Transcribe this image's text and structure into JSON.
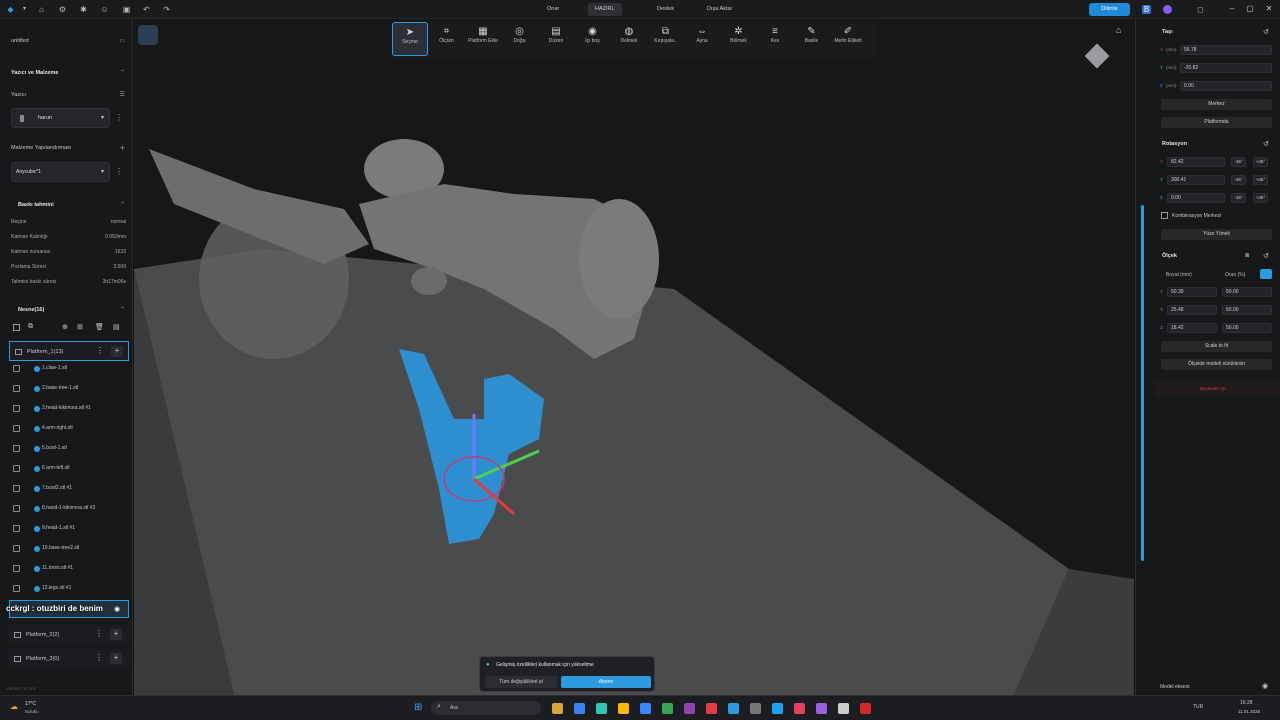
{
  "topbar": {
    "tabs": [
      {
        "label": "Onar"
      },
      {
        "label": "HAZIRL"
      },
      {
        "label": "Destek"
      },
      {
        "label": "Dışa Aktar"
      }
    ],
    "slice_label": "Dilimle"
  },
  "left": {
    "project_name": "untitled",
    "printer_section": "Yazıcı ve Malzeme",
    "printer_label": "Yazıcı",
    "printer_value": "harun",
    "material_label": "Malzeme Yapılandırması",
    "material_value": "Anycubic*1",
    "estimate_title": "Baskı tahmini",
    "estimates": [
      {
        "k": "Reçine",
        "v": "normal"
      },
      {
        "k": "Katman Kalınlığı",
        "v": "0.050mm"
      },
      {
        "k": "Katman numarası",
        "v": "1633"
      },
      {
        "k": "Pozlama Süresi",
        "v": "3.500"
      },
      {
        "k": "Tahmini baskı süresi",
        "v": "3h17m06s"
      }
    ],
    "objects_title": "Nesne(16)",
    "platform1": "Platform_1(13)",
    "objects": [
      "1.claw-1.stl",
      "2.base-tree-1.stl",
      "3.head-kikimora.stl #1",
      "4.arm-right.stl",
      "5.boot-1.stl",
      "6.arm-left.stl",
      "7.boot2.stl #1",
      "8.hand-1-kikimora.stl #2",
      "9.head-1.stl #1",
      "10.base-tree2.stl",
      "11.torso.stl #1",
      "12.legs.stl #1"
    ],
    "chat_overlay": "cckrgl : otuzbiri de benim",
    "platform2": "Platform_2(2)",
    "platform3": "Platform_3(0)",
    "version": "Version: v1.8.8"
  },
  "toolbar": [
    "Seçme",
    "Ölçüm",
    "Platform Ekle",
    "Doğu",
    "Düzen",
    "İçi boş",
    "Delmek",
    "Kırpıyala..",
    "Ayna",
    "Bölmek",
    "Kes",
    "Basile",
    "Metin Etiketi"
  ],
  "right": {
    "move_title": "Taşı",
    "move": [
      {
        "axis": "X",
        "unit": "(mm)",
        "v": "56.78"
      },
      {
        "axis": "Y",
        "unit": "(mm)",
        "v": "-20.82"
      },
      {
        "axis": "Z",
        "unit": "(mm)",
        "v": "0.00"
      }
    ],
    "center_btn": "Merkez",
    "platform_btn": "Platformda",
    "rotate_title": "Rotasyon",
    "rotate": [
      {
        "axis": "X",
        "v": "82.42"
      },
      {
        "axis": "Y",
        "v": "300.41"
      },
      {
        "axis": "Z",
        "v": "0.00"
      }
    ],
    "deg_minus": "-45°",
    "deg_plus": "+45°",
    "combo_label": "Kombinasyon Merkezi",
    "face_btn": "Yüze Yönelt",
    "scale_title": "Ölçek",
    "scale_size_label": "Boyut (mm)",
    "scale_ratio_label": "Oran (%)",
    "scale": [
      {
        "axis": "X",
        "size": "50.30",
        "ratio": "50.00"
      },
      {
        "axis": "Y",
        "size": "25.48",
        "ratio": "50.00"
      },
      {
        "axis": "Z",
        "size": "18.42",
        "ratio": "50.00"
      }
    ],
    "fit_btn": "Scale to fit",
    "shrink_btn": "Ölçekte modeli sürüklesin",
    "warning": "Modelden tip",
    "model_label": "Model ekseni"
  },
  "toast": {
    "title": "Gelişmiş özellikleri kullanmak için yükseltme",
    "all_btn": "Tüm değişiklikleri al",
    "subscribe_btn": "Abone"
  },
  "taskbar": {
    "weather": "17°C",
    "weather_sub": "Bulutlu",
    "search": "Ara",
    "lang": "TUR",
    "time": "16:28",
    "date": "11.01.2026"
  }
}
